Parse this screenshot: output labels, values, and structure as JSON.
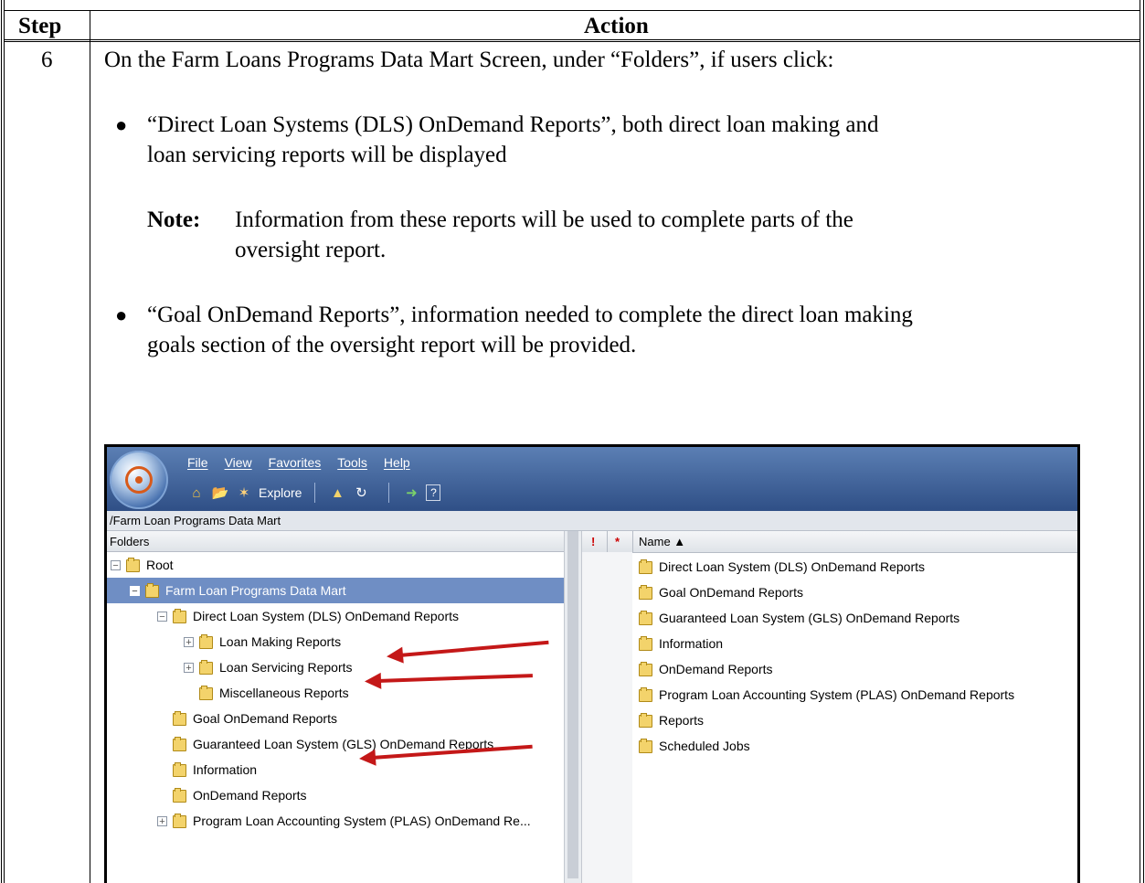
{
  "table": {
    "header_step": "Step",
    "header_action": "Action",
    "step_number": "6",
    "intro": "On the Farm Loans Programs Data Mart Screen, under “Folders”, if users click:",
    "bullet1_line1": "“Direct Loan Systems (DLS) OnDemand Reports”, both direct loan making and",
    "bullet1_line2": "loan servicing reports will be displayed",
    "note_label": "Note:",
    "note_line1": "Information from these reports will be used to complete parts of the",
    "note_line2": "oversight report.",
    "bullet2_line1": "“Goal OnDemand Reports”, information needed to complete the direct loan making",
    "bullet2_line2": "goals section of the oversight report will be provided."
  },
  "app": {
    "menu": [
      "File",
      "View",
      "Favorites",
      "Tools",
      "Help"
    ],
    "toolbar": {
      "home_icon": "home-icon",
      "folder_icon": "open-folder-icon",
      "explore_icon": "explore-icon",
      "explore_label": "Explore",
      "up_icon": "folder-up-icon",
      "refresh_icon": "refresh-icon",
      "logoff_icon": "log-off-icon",
      "help_icon": "help-icon"
    },
    "path": "/Farm Loan Programs Data Mart",
    "folders_header": "Folders",
    "tree": [
      {
        "label": "Root",
        "expander": "−"
      },
      {
        "label": "Farm Loan Programs Data Mart",
        "expander": "−"
      },
      {
        "label": "Direct Loan System (DLS) OnDemand Reports",
        "expander": "−"
      },
      {
        "label": "Loan Making Reports",
        "expander": "+"
      },
      {
        "label": "Loan Servicing Reports",
        "expander": "+"
      },
      {
        "label": "Miscellaneous Reports",
        "expander": ""
      },
      {
        "label": "Goal OnDemand Reports",
        "expander": ""
      },
      {
        "label": "Guaranteed Loan System (GLS) OnDemand Reports",
        "expander": ""
      },
      {
        "label": "Information",
        "expander": ""
      },
      {
        "label": "OnDemand Reports",
        "expander": ""
      },
      {
        "label": "Program Loan Accounting System (PLAS) OnDemand Re...",
        "expander": "+"
      }
    ],
    "list_header": {
      "priority": "!",
      "required": "*",
      "name": "Name ▲"
    },
    "list": [
      "Direct Loan System (DLS) OnDemand Reports",
      "Goal OnDemand Reports",
      "Guaranteed Loan System (GLS) OnDemand Reports",
      "Information",
      "OnDemand Reports",
      "Program Loan Accounting System (PLAS) OnDemand Reports",
      "Reports",
      "Scheduled Jobs"
    ],
    "colors": {
      "title_bar": "#2f4f86",
      "selected_row": "#6f8ec4",
      "annotation_arrow": "#c41818",
      "folder": "#f3d36b"
    }
  }
}
